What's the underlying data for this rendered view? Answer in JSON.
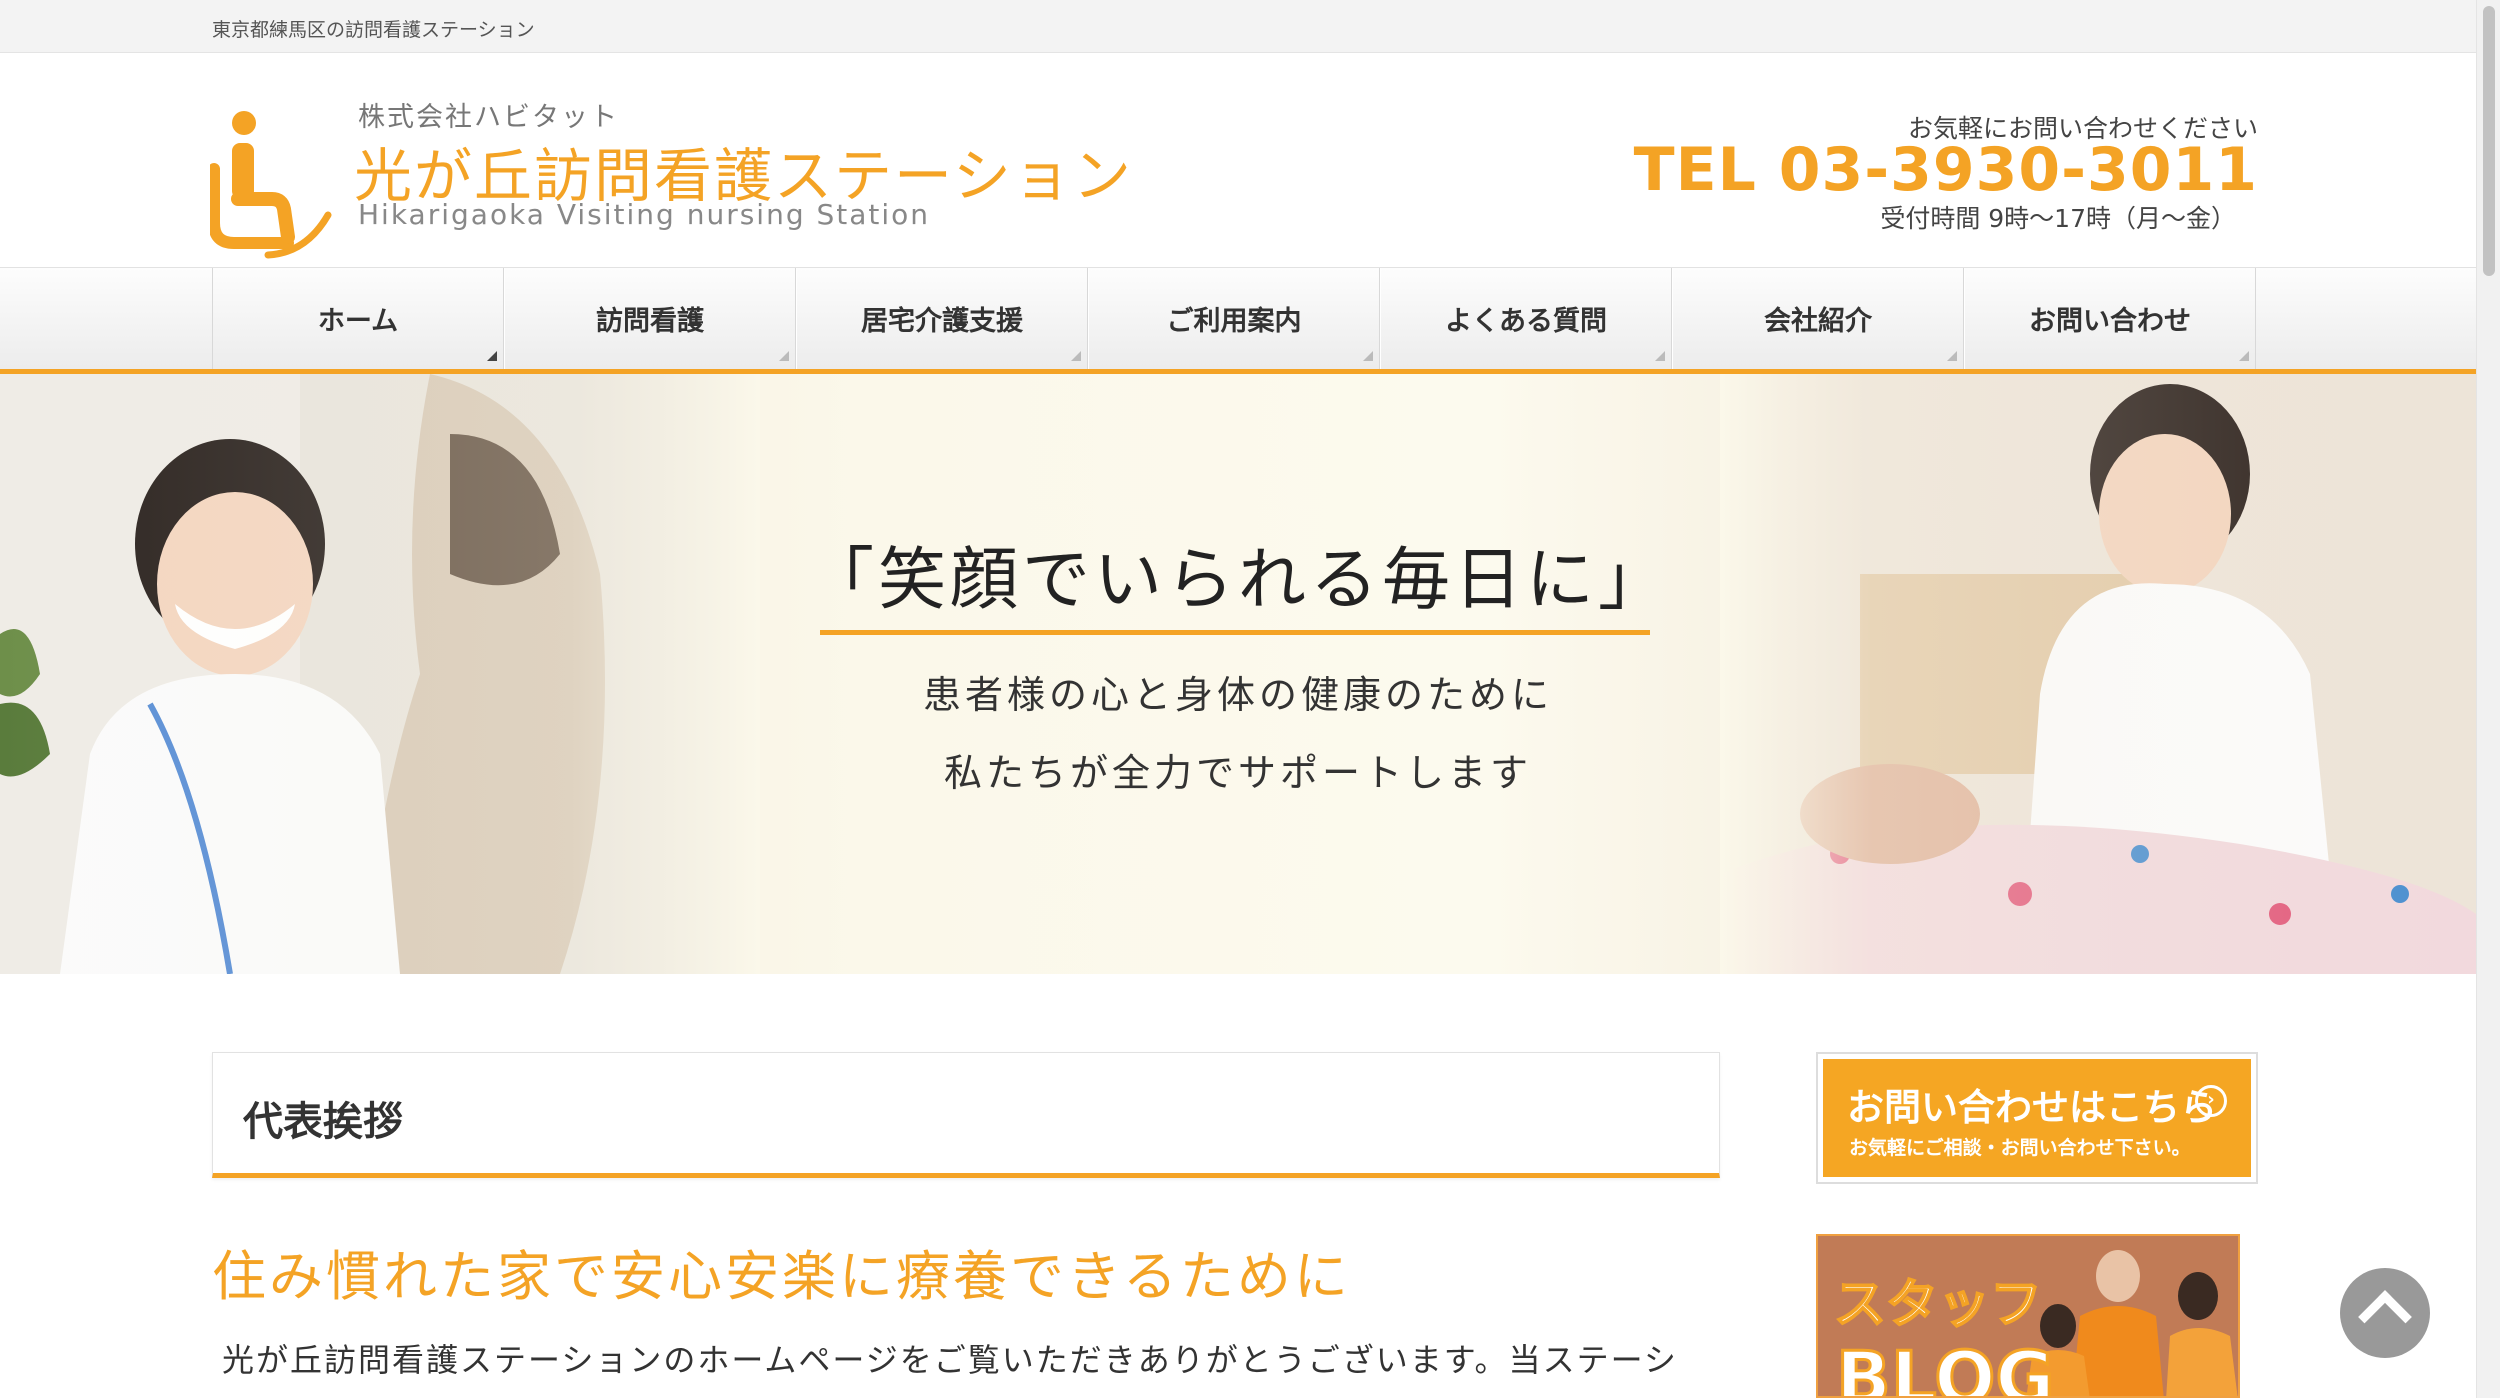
{
  "topbar": {
    "text": "東京都練馬区の訪問看護ステーション"
  },
  "header": {
    "company": "株式会社ハビタット",
    "site_name": "光が丘訪問看護ステーション",
    "site_name_en": "Hikarigaoka Visiting nursing Station",
    "contact_lead": "お気軽にお問い合わせください",
    "tel": "TEL 03-3930-3011",
    "hours": "受付時間 9時〜17時（月〜金）"
  },
  "nav": {
    "items": [
      {
        "label": "ホーム"
      },
      {
        "label": "訪問看護"
      },
      {
        "label": "居宅介護支援"
      },
      {
        "label": "ご利用案内"
      },
      {
        "label": "よくある質問"
      },
      {
        "label": "会社紹介"
      },
      {
        "label": "お問い合わせ"
      }
    ],
    "active_index": 0
  },
  "hero": {
    "title": "「笑顔でいられる毎日に」",
    "sub1": "患者様の心と身体の健康のために",
    "sub2": "私たちが全力でサポートします"
  },
  "main": {
    "section_title": "代表挨拶",
    "lead": "住み慣れた家で安心安楽に療養できるために",
    "body": "光が丘訪問看護ステーションのホームページをご覧いただきありがとうございます。当ステーシ"
  },
  "sidebar": {
    "contact_title": "お問い合わせはこちら",
    "contact_sub": "お気軽にご相談・お問い合わせ下さい。",
    "blog_top": "スタッフ",
    "blog_bottom": "BLOG"
  },
  "colors": {
    "accent": "#f4a325",
    "text": "#333333"
  },
  "icons": {
    "logo": "wheelchair-person-icon",
    "to_top": "chevron-up-icon",
    "contact_arrow": "circle-arrow-right-icon"
  }
}
